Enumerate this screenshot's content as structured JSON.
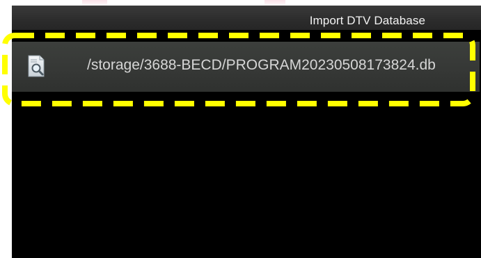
{
  "dialog": {
    "title": "Import DTV Database"
  },
  "file_list": {
    "items": [
      {
        "icon": "file-search-icon",
        "path": "/storage/3688-BECD/PROGRAM20230508173824.db"
      }
    ]
  },
  "annotation": {
    "color": "#ffff00"
  }
}
